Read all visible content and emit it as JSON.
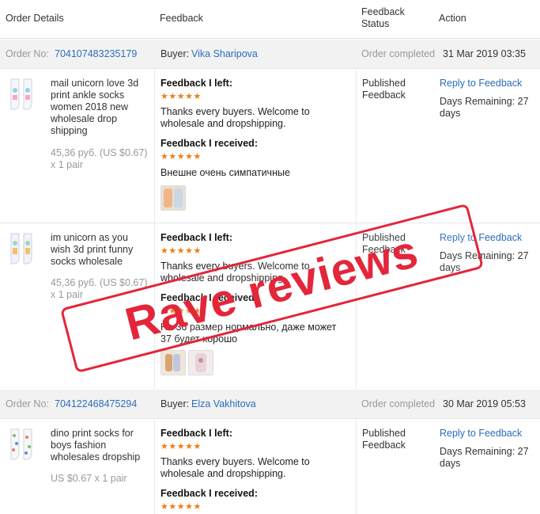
{
  "headers": {
    "order_details": "Order Details",
    "feedback": "Feedback",
    "feedback_status_line1": "Feedback",
    "feedback_status_line2": "Status",
    "action": "Action"
  },
  "orders": [
    {
      "order_no_label": "Order No:",
      "order_no": "704107483235179",
      "buyer_label": "Buyer:",
      "buyer": "Vika Sharipova",
      "status": "Order completed",
      "date": "31 Mar 2019 03:35",
      "items": [
        {
          "title_lines": [
            "mail unicorn love 3d",
            "print ankle socks",
            "women 2018 new",
            "wholesale drop",
            "shipping"
          ],
          "price_lines": [
            "45,36 руб. (US $0.67)",
            "x 1 pair"
          ],
          "left_label": "Feedback I left:",
          "left_stars": "★★★★★",
          "left_text_lines": [
            "Thanks every buyers. Welcome to",
            "wholesale and dropshipping."
          ],
          "received_label": "Feedback I received:",
          "received_stars": "★★★★★",
          "received_text_lines": [
            "Внешне очень симпатичные"
          ],
          "status_lines": [
            "Published",
            "Feedback"
          ],
          "reply": "Reply to Feedback",
          "days_lines": [
            "Days Remaining: 27",
            "days"
          ]
        },
        {
          "title_lines": [
            "im unicorn as you",
            "wish 3d print funny",
            "socks wholesale"
          ],
          "price_lines": [
            "45,36 руб. (US $0.67)",
            "x 1 pair"
          ],
          "left_label": "Feedback I left:",
          "left_stars": "★★★★★",
          "left_text_lines": [
            "Thanks every buyers. Welcome to",
            "wholesale and dropshipping."
          ],
          "received_label": "Feedback I received:",
          "received_stars": "★★★★★",
          "received_text_lines": [
            "На 36 размер нормально, даже может",
            "37 будет хорошо"
          ],
          "status_lines": [
            "Published",
            "Feedback"
          ],
          "reply": "Reply to Feedback",
          "days_lines": [
            "Days Remaining: 27",
            "days"
          ]
        }
      ]
    },
    {
      "order_no_label": "Order No:",
      "order_no": "704122468475294",
      "buyer_label": "Buyer:",
      "buyer": "Elza Vakhitova",
      "status": "Order completed",
      "date": "30 Mar 2019 05:53",
      "items": [
        {
          "title_lines": [
            "dino print socks for",
            "boys fashion",
            "wholesales dropship"
          ],
          "price_lines": [
            "US $0.67 x 1 pair"
          ],
          "left_label": "Feedback I left:",
          "left_stars": "★★★★★",
          "left_text_lines": [
            "Thanks every buyers. Welcome to",
            "wholesale and dropshipping."
          ],
          "received_label": "Feedback I received:",
          "received_stars": "★★★★★",
          "status_lines": [
            "Published",
            "Feedback"
          ],
          "reply": "Reply to Feedback",
          "days_lines": [
            "Days Remaining: 27",
            "days"
          ]
        }
      ]
    }
  ],
  "stamp": {
    "text": "Rave reviews",
    "color": "#e3263a"
  },
  "colors": {
    "link": "#2a6ebb",
    "stars": "#f07e14",
    "bar_bg": "#f2f2f2"
  }
}
